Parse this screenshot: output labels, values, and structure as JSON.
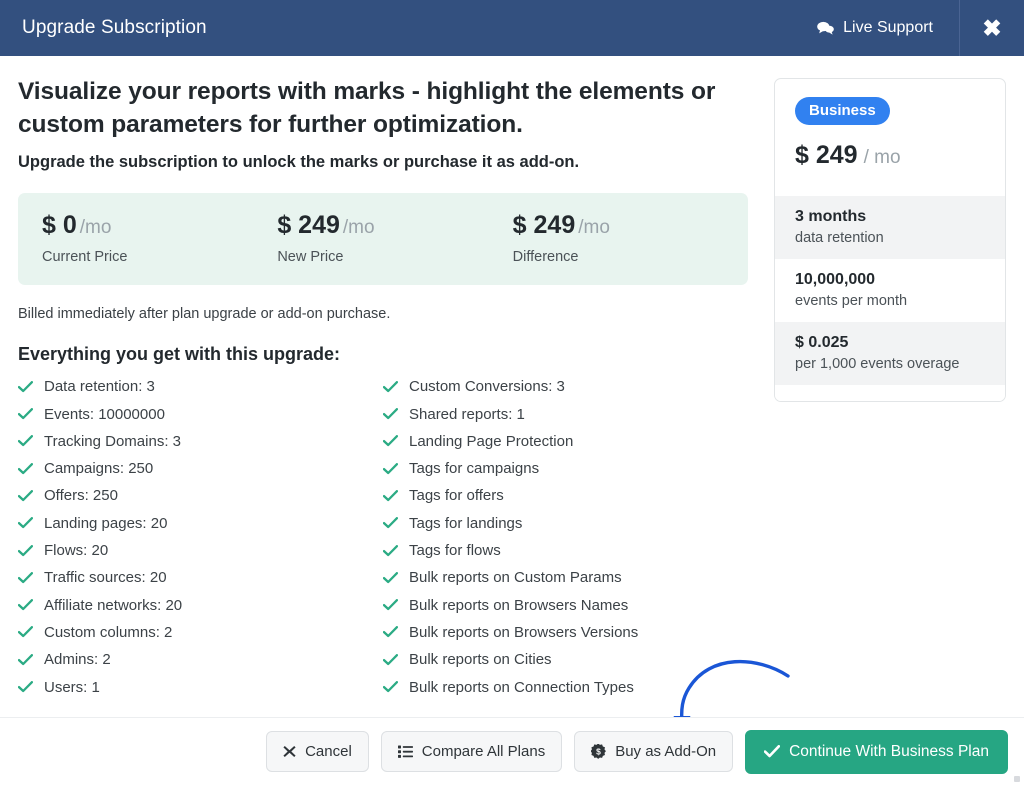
{
  "colors": {
    "header_bg": "#33507f",
    "accent_green": "#26a683",
    "badge_blue": "#3181f0",
    "price_strip_bg": "#e8f4ef",
    "arrow_blue": "#1a56d6",
    "tick_green": "#2bab84"
  },
  "titlebar": {
    "title": "Upgrade Subscription",
    "support_label": "Live Support",
    "support_icon": "chat-bubble-icon",
    "close_icon": "close-icon",
    "close_glyph": "✖"
  },
  "main": {
    "headline": "Visualize your reports with marks - highlight the elements or custom parameters for further optimization.",
    "subhead": "Upgrade the subscription to unlock the marks or purchase it as add-on.",
    "billed_note": "Billed immediately after plan upgrade or add-on purchase.",
    "features_title": "Everything you get with this upgrade:"
  },
  "price_strip": [
    {
      "amount": "$ 0",
      "per": "/mo",
      "label": "Current Price"
    },
    {
      "amount": "$ 249",
      "per": "/mo",
      "label": "New Price"
    },
    {
      "amount": "$ 249",
      "per": "/mo",
      "label": "Difference"
    }
  ],
  "features": {
    "left": [
      "Data retention: 3",
      "Events: 10000000",
      "Tracking Domains: 3",
      "Campaigns: 250",
      "Offers: 250",
      "Landing pages: 20",
      "Flows: 20",
      "Traffic sources: 20",
      "Affiliate networks: 20",
      "Custom columns: 2",
      "Admins: 2",
      "Users: 1"
    ],
    "right": [
      "Custom Conversions: 3",
      "Shared reports: 1",
      "Landing Page Protection",
      "Tags for campaigns",
      "Tags for offers",
      "Tags for landings",
      "Tags for flows",
      "Bulk reports on Custom Params",
      "Bulk reports on Browsers Names",
      "Bulk reports on Browsers Versions",
      "Bulk reports on Cities",
      "Bulk reports on Connection Types"
    ]
  },
  "plan_card": {
    "badge": "Business",
    "price": "$ 249",
    "price_per": "/ mo",
    "rows": [
      {
        "big": "3 months",
        "small": "data retention"
      },
      {
        "big": "10,000,000",
        "small": "events per month"
      },
      {
        "big": "$ 0.025",
        "small": "per 1,000 events overage"
      }
    ]
  },
  "footer": {
    "cancel": "Cancel",
    "cancel_icon": "close-icon",
    "compare": "Compare All Plans",
    "compare_icon": "list-icon",
    "addon": "Buy as Add-On",
    "addon_icon": "dollar-badge-icon",
    "continue": "Continue With Business Plan",
    "continue_icon": "check-icon"
  }
}
